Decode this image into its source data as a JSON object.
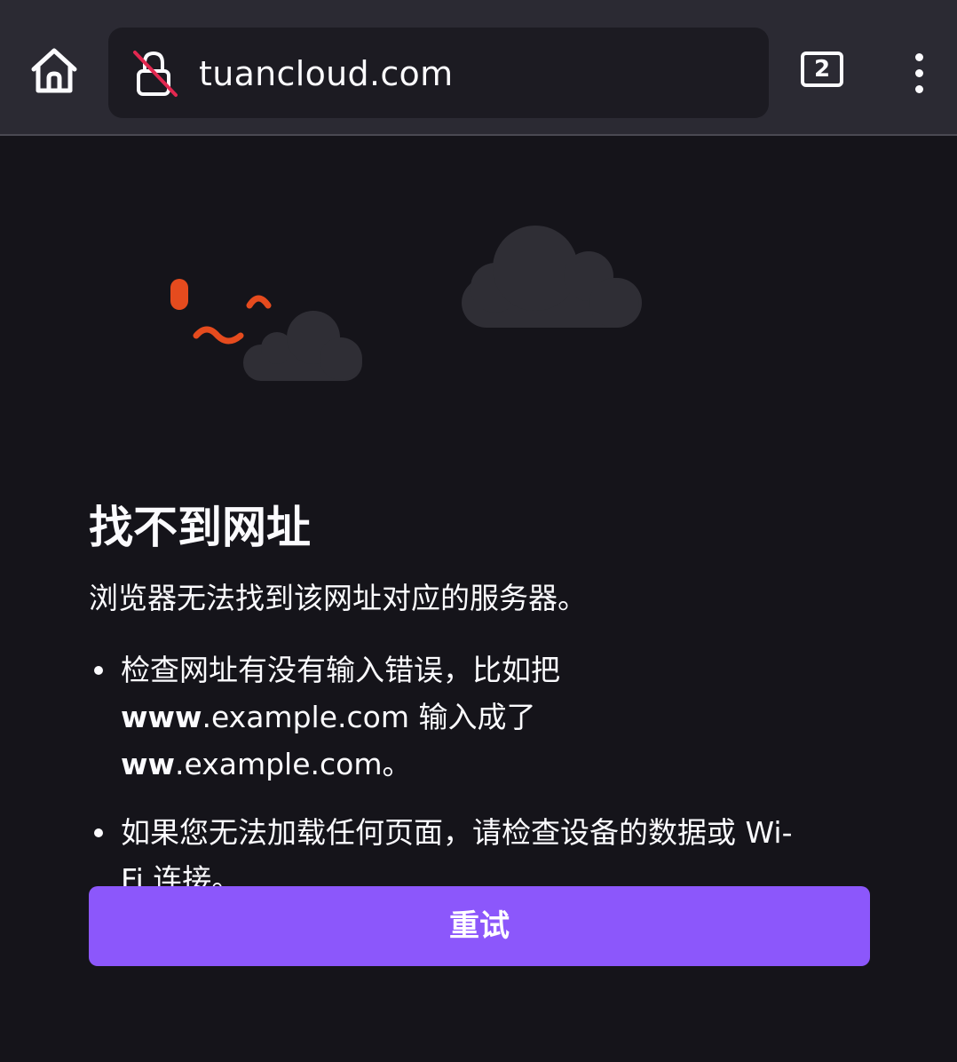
{
  "toolbar": {
    "url": "tuancloud.com",
    "tab_count": "2",
    "home_icon": "home-icon",
    "lock_icon": "insecure-lock-icon",
    "menu_icon": "more-vertical-icon"
  },
  "error": {
    "title": "找不到网址",
    "description": "浏览器无法找到该网址对应的服务器。",
    "bullet1": {
      "line1": "检查网址有没有输入错误，比如把",
      "bold1": "www",
      "rest1": ".example.com 输入成了 ",
      "bold2": "ww",
      "rest2": ".example.com。"
    },
    "bullet2": {
      "text": "如果您无法加载任何页面，请检查设备的数据或 Wi-",
      "text2": "Fi 连接。"
    },
    "retry_label": "重试"
  },
  "colors": {
    "toolbar_bg": "#2b2a33",
    "page_bg": "#15141a",
    "accent": "#8c57fb",
    "warning": "#e54b1e",
    "cloud": "#2f2e35"
  }
}
